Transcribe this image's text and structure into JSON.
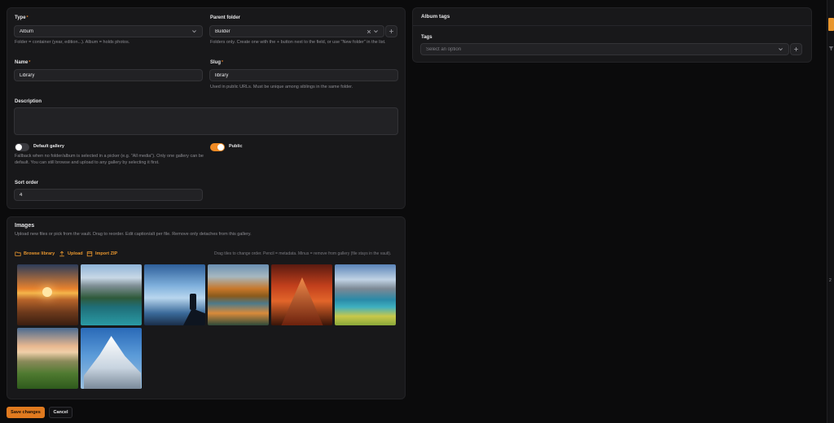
{
  "form": {
    "type_label": "Type",
    "type_value": "Album",
    "type_help": "Folder = container (year, edition...). Album = holds photos.",
    "parent_label": "Parent folder",
    "parent_value": "Builder",
    "parent_help": "Folders only. Create one with the + button next to the field, or use \"New folder\" in the list.",
    "name_label": "Name",
    "name_value": "Library",
    "slug_label": "Slug",
    "slug_value": "library",
    "slug_help": "Used in public URLs. Must be unique among siblings in the same folder.",
    "description_label": "Description",
    "description_value": "",
    "default_gallery_label": "Default gallery",
    "default_gallery_on": false,
    "default_gallery_help": "Fallback when no folder/album is selected in a picker (e.g. \"All media\"). Only one gallery can be default. You can still browse and upload to any gallery by selecting it first.",
    "public_label": "Public",
    "public_on": true,
    "sort_label": "Sort order",
    "sort_value": "4",
    "required_mark": "*"
  },
  "images": {
    "title": "Images",
    "subtitle": "Upload new files or pick from the vault. Drag to reorder. Edit caption/alt per file. Remove only detaches from this gallery.",
    "browse_label": "Browse library",
    "upload_label": "Upload",
    "import_label": "Import ZIP",
    "hint": "Drag tiles to change order. Pencil = metadata. Minus = remove from gallery (file stays in the vault).",
    "thumbnails": [
      "sunset-valley",
      "alpine-lake",
      "misty-hiker",
      "autumn-lake",
      "red-peak",
      "lake-village",
      "golden-hills",
      "snow-peak"
    ]
  },
  "tags": {
    "title": "Album tags",
    "label": "Tags",
    "placeholder": "Select an option"
  },
  "footer": {
    "save_label": "Save changes",
    "cancel_label": "Cancel"
  },
  "edge": {
    "number": "2"
  },
  "colors": {
    "accent": "#e8962e",
    "save_button": "#e07a1f",
    "toggle_on": "#f08a24",
    "toggle_off": "#3a3a3f"
  },
  "icons": [
    "chevron-down-icon",
    "clear-icon",
    "plus-icon",
    "folder-icon",
    "upload-icon",
    "zip-icon",
    "filter-icon"
  ]
}
